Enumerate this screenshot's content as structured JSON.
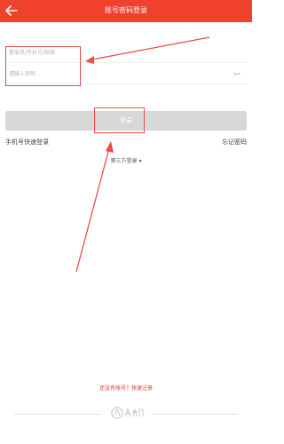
{
  "header": {
    "title": "账号密码登录",
    "background": "#f0412f"
  },
  "form": {
    "username_placeholder": "登录名/手机号/邮箱",
    "password_placeholder": "请输入密码",
    "password_toggle_icon": "eye-closed-icon"
  },
  "login_button": {
    "label": "登录",
    "background": "#d7d7d7"
  },
  "links": {
    "sms_login": "手机号快速登录",
    "forgot_password": "忘记密码",
    "third_party": "第三方登录 ▾",
    "register": "还没有账号？快速注册"
  },
  "footer": {
    "logo": "people-daily-logo"
  },
  "annotation": {
    "color": "#f04a4a"
  }
}
